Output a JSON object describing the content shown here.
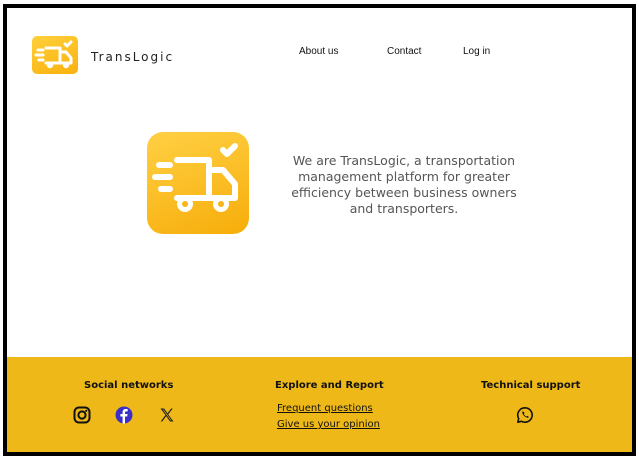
{
  "header": {
    "brand": "TransLogic",
    "nav": {
      "about": "About us",
      "contact": "Contact",
      "login": "Log in"
    }
  },
  "hero": {
    "text": "We are TransLogic, a transportation management platform for greater efficiency between business owners and transporters."
  },
  "footer": {
    "social": {
      "title": "Social networks",
      "icons": [
        "instagram-icon",
        "facebook-icon",
        "x-icon"
      ]
    },
    "explore": {
      "title": "Explore and Report",
      "links": [
        "Frequent questions",
        "Give us your opinion"
      ]
    },
    "support": {
      "title": "Technical support",
      "icon": "whatsapp-icon"
    }
  },
  "colors": {
    "accent": "#eeb918",
    "logo_top": "#ffcf3a",
    "logo_bottom": "#f9b20f",
    "facebook": "#3b2fc9"
  }
}
